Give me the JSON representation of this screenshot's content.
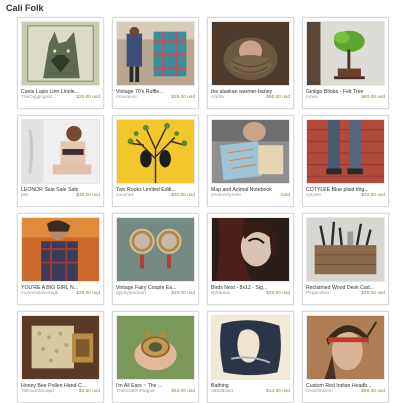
{
  "page": {
    "title": "Cali Folk"
  },
  "items": [
    {
      "name": "Canis Lupis Linn Linole...",
      "shop": "TheDiggingest...",
      "price": "$20.00 usd",
      "thumb": "wolf-print"
    },
    {
      "name": "Vintage 70's Ruffle...",
      "shop": "mousevol",
      "price": "$28.00 usd",
      "thumb": "plaid-shirt-photo"
    },
    {
      "name": "the alaskan warmer-barley",
      "shop": "czetta",
      "price": "$80.00 usd",
      "thumb": "knit-cowl-photo"
    },
    {
      "name": "Ginkgo Biloba - Felt Tree",
      "shop": "mhes",
      "price": "$80.00 usd",
      "thumb": "felt-tree-photo"
    },
    {
      "name": "LEONOR Sale Sale Sale",
      "shop": "phil",
      "price": "$35.00 usd",
      "thumb": "lingerie-photo"
    },
    {
      "name": "Two Rooks Limited Editi...",
      "shop": "couchee",
      "price": "$30.00 usd",
      "thumb": "rooks-print"
    },
    {
      "name": "Map and Animal Notebook",
      "shop": "yeahusrtyrinte",
      "price": "Sold",
      "thumb": "notebook-photo"
    },
    {
      "name": "COTYLEE Blue plaid thig...",
      "shop": "cotylee",
      "price": "$22.00 usd",
      "thumb": "socks-photo"
    },
    {
      "name": "YOU'RE A BIG GIRL N...",
      "shop": "moonchildvintage",
      "price": "$26.00 usd",
      "thumb": "flannel-photo"
    },
    {
      "name": "Vintage Fairy Couple Ea...",
      "shop": "gypsymoonart",
      "price": "$25.00 usd",
      "thumb": "earrings-photo"
    },
    {
      "name": "Birds Nest - 8x12 - Sig...",
      "shop": "lightbeas",
      "price": "$36.00 usd",
      "thumb": "birds-nest-photo"
    },
    {
      "name": "Reclaimed Wood Desk Cad...",
      "shop": "Pegandkai",
      "price": "$30.00 usd",
      "thumb": "desk-caddy-photo"
    },
    {
      "name": "Honey Bee Pollen Hand-C...",
      "shop": "TalluvansSoaps",
      "price": "$4.50 usd",
      "thumb": "soap-photo"
    },
    {
      "name": "I'm All Ears ~ The ...",
      "shop": "TheGoldenPlague",
      "price": "$84.00 usd",
      "thumb": "ring-photo"
    },
    {
      "name": "Bathing",
      "shop": "rabbitblast",
      "price": "$14.00 usd",
      "thumb": "bathing-print"
    },
    {
      "name": "Custom Red Indian Headb...",
      "shop": "DearOhDeer",
      "price": "$98.00 usd",
      "thumb": "headband-photo"
    }
  ]
}
